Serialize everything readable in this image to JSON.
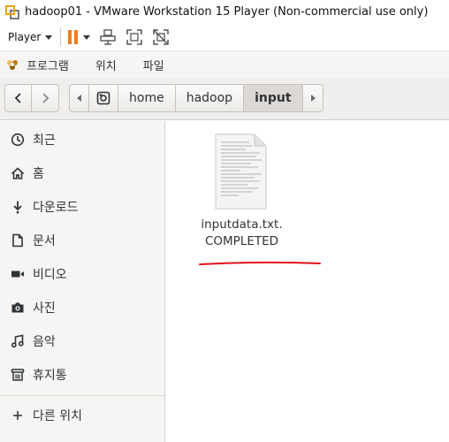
{
  "window": {
    "title": "hadoop01 - VMware Workstation 15 Player (Non-commercial use only)"
  },
  "player_toolbar": {
    "player_label": "Player"
  },
  "app_menu": {
    "items": [
      "프로그램",
      "위치",
      "파일"
    ]
  },
  "path_bar": {
    "segments": [
      "home",
      "hadoop",
      "input"
    ],
    "active": "input"
  },
  "sidebar": {
    "items": [
      {
        "label": "최근",
        "icon": "clock-icon"
      },
      {
        "label": "홈",
        "icon": "home-icon"
      },
      {
        "label": "다운로드",
        "icon": "download-icon"
      },
      {
        "label": "문서",
        "icon": "document-icon"
      },
      {
        "label": "비디오",
        "icon": "video-icon"
      },
      {
        "label": "사진",
        "icon": "camera-icon"
      },
      {
        "label": "음악",
        "icon": "music-icon"
      },
      {
        "label": "휴지통",
        "icon": "trash-icon"
      }
    ],
    "other_locations": "다른 위치"
  },
  "files": [
    {
      "name_line1": "inputdata.txt.",
      "name_line2": "COMPLETED"
    }
  ],
  "colors": {
    "vmware_orange": "#e8a317",
    "pause_orange": "#f07c1f",
    "annotation_red": "#e0101a"
  }
}
